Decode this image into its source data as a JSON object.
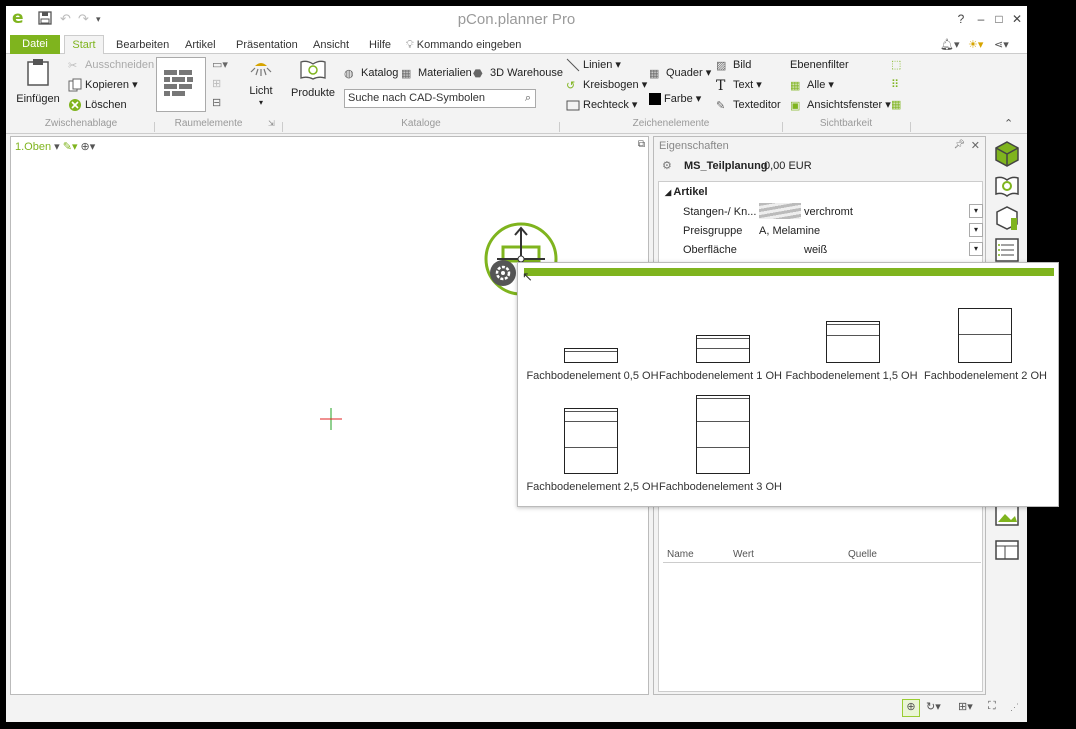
{
  "window": {
    "title": "pCon.planner Pro"
  },
  "title_controls": {
    "help": "?",
    "minimize": "–",
    "maximize": "□",
    "close": "✕"
  },
  "tabs": [
    "Datei",
    "Start",
    "Bearbeiten",
    "Artikel",
    "Präsentation",
    "Ansicht",
    "Hilfe"
  ],
  "command": "Kommando eingeben",
  "ribbon": {
    "clipboard": {
      "paste": "Einfügen",
      "cut": "Ausschneiden",
      "copy": "Kopieren",
      "delete": "Löschen",
      "group": "Zwischenablage"
    },
    "room": {
      "group": "Raumelemente",
      "light": "Licht",
      "products": "Produkte"
    },
    "catalogs": {
      "catalog": "Katalog",
      "materials": "Materialien",
      "warehouse": "3D Warehouse",
      "search_value": "Suche nach CAD-Symbolen",
      "group": "Kataloge"
    },
    "draw": {
      "lines": "Linien",
      "arc": "Kreisbogen",
      "rect": "Rechteck",
      "box": "Quader",
      "color": "Farbe",
      "image": "Bild",
      "text": "Text",
      "texteditor": "Texteditor",
      "group": "Zeichenelemente"
    },
    "visibility": {
      "layerfilter": "Ebenenfilter",
      "all": "Alle",
      "viewwindow": "Ansichtsfenster",
      "group": "Sichtbarkeit"
    }
  },
  "view": {
    "label": "1.Oben"
  },
  "properties": {
    "title": "Eigenschaften",
    "article_name": "MS_Teilplanung",
    "price": "0,00 EUR",
    "section": "Artikel",
    "rows": [
      {
        "label": "Stangen-/ Kn...",
        "value": "verchromt"
      },
      {
        "label": "Preisgruppe",
        "value": "A, Melamine"
      },
      {
        "label": "Oberfläche",
        "value": "weiß"
      }
    ],
    "table_headers": [
      "Name",
      "Wert",
      "Quelle"
    ]
  },
  "popup": {
    "items": [
      {
        "label": "Fachbodenelement 0,5 OH",
        "shelves": 0.5
      },
      {
        "label": "Fachbodenelement 1 OH",
        "shelves": 1
      },
      {
        "label": "Fachbodenelement 1,5 OH",
        "shelves": 1.5
      },
      {
        "label": "Fachbodenelement 2 OH",
        "shelves": 2
      },
      {
        "label": "Fachbodenelement 2,5 OH",
        "shelves": 2.5
      },
      {
        "label": "Fachbodenelement 3 OH",
        "shelves": 3
      }
    ]
  },
  "colors": {
    "accent": "#7fb41e",
    "cursor_red": "#e02020",
    "cursor_green": "#20a020"
  }
}
